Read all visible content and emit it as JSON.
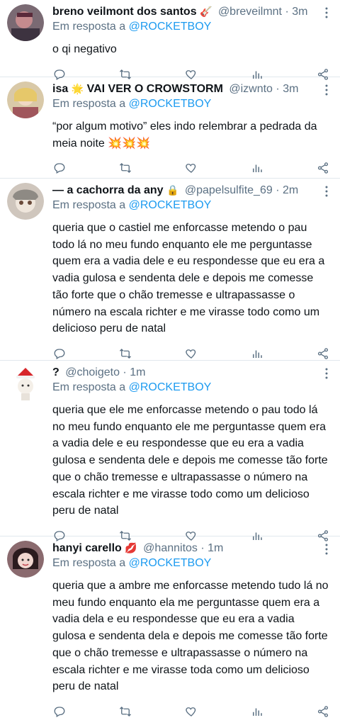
{
  "colors": {
    "link": "#1d9bf0",
    "secondary": "#5b7083",
    "divider": "#e1e8ed"
  },
  "tweets": [
    {
      "display_name": "breno veilmont dos santos",
      "name_emoji": "🎸",
      "handle": "@breveilmnt",
      "dot": "·",
      "time": "3m",
      "reply_prefix": "Em resposta a",
      "reply_to": "@ROCKETBOY",
      "text": "o qi negativo"
    },
    {
      "display_name_prefix": "isa",
      "name_emoji": "🌟",
      "display_name": "VAI VER O CROWSTORM",
      "handle": "@izwnto",
      "dot": "·",
      "time": "3m",
      "reply_prefix": "Em resposta a",
      "reply_to": "@ROCKETBOY",
      "text": "“por algum motivo” eles indo relembrar a pedrada da meia noite 💥💥💥"
    },
    {
      "display_name": "— a cachorra da any",
      "name_emoji": "🔒",
      "handle": "@papelsulfite_69",
      "dot": "·",
      "time": "2m",
      "reply_prefix": "Em resposta a",
      "reply_to": "@ROCKETBOY",
      "text": "queria que o castiel me enforcasse metendo o pau todo lá no meu fundo enquanto ele me perguntasse quem era a vadia dele e eu respondesse que eu era a vadia gulosa e sendenta dele e depois me comesse tão forte que o chão tremesse e ultrapassasse o número na escala richter e me virasse todo como um delicioso peru de natal"
    },
    {
      "display_name": "?",
      "handle": "@choigeto",
      "dot": "·",
      "time": "1m",
      "reply_prefix": "Em resposta a",
      "reply_to": "@ROCKETBOY",
      "text": "queria que ele me enforcasse metendo o pau todo lá no meu fundo enquanto ele me perguntasse quem era a vadia dele e eu respondesse que eu era a vadia gulosa e sendenta dele e depois me comesse tão forte que o chão tremesse e ultrapassasse o número na escala richter e me virasse todo como um delicioso peru de natal"
    },
    {
      "display_name": "hanyi carello",
      "name_emoji": "💋",
      "handle": "@hannitos",
      "dot": "·",
      "time": "1m",
      "reply_prefix": "Em resposta a",
      "reply_to": "@ROCKETBOY",
      "text": "queria que a ambre me enforcasse metendo tudo lá no meu fundo enquanto ela me perguntasse quem era a vadia dela e eu respondesse que eu era a vadia gulosa e sendenta dela e depois me comesse tão forte que o chão tremesse e ultrapassasse o número na escala richter e me virasse toda como um delicioso peru de natal"
    }
  ]
}
